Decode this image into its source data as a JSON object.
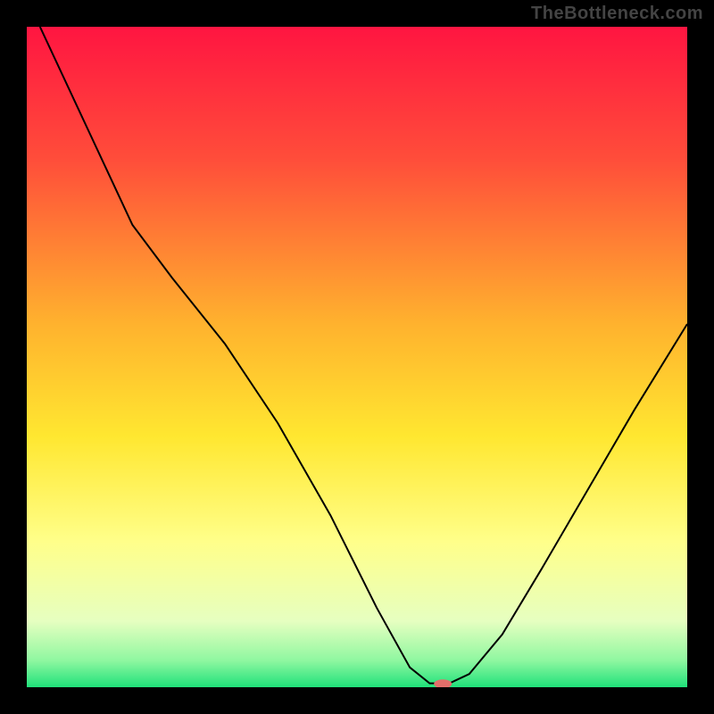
{
  "watermark": "TheBottleneck.com",
  "chart_data": {
    "type": "line",
    "title": "",
    "xlabel": "",
    "ylabel": "",
    "xlim": [
      0,
      100
    ],
    "ylim": [
      0,
      100
    ],
    "grid": false,
    "legend": false,
    "background_gradient_stops": [
      {
        "pct": 0,
        "color": "#ff1541"
      },
      {
        "pct": 20,
        "color": "#ff4d3a"
      },
      {
        "pct": 45,
        "color": "#ffb22e"
      },
      {
        "pct": 62,
        "color": "#ffe730"
      },
      {
        "pct": 78,
        "color": "#ffff8a"
      },
      {
        "pct": 90,
        "color": "#e6ffc0"
      },
      {
        "pct": 96,
        "color": "#8ef7a0"
      },
      {
        "pct": 100,
        "color": "#1fe17a"
      }
    ],
    "series": [
      {
        "name": "bottleneck-curve",
        "color": "#000000",
        "stroke_width": 2,
        "points": [
          {
            "x": 2,
            "y": 100
          },
          {
            "x": 9,
            "y": 85
          },
          {
            "x": 16,
            "y": 70
          },
          {
            "x": 22,
            "y": 62
          },
          {
            "x": 30,
            "y": 52
          },
          {
            "x": 38,
            "y": 40
          },
          {
            "x": 46,
            "y": 26
          },
          {
            "x": 53,
            "y": 12
          },
          {
            "x": 58,
            "y": 3
          },
          {
            "x": 61,
            "y": 0.6
          },
          {
            "x": 64,
            "y": 0.6
          },
          {
            "x": 67,
            "y": 2
          },
          {
            "x": 72,
            "y": 8
          },
          {
            "x": 78,
            "y": 18
          },
          {
            "x": 85,
            "y": 30
          },
          {
            "x": 92,
            "y": 42
          },
          {
            "x": 100,
            "y": 55
          }
        ]
      }
    ],
    "marker": {
      "name": "sweet-spot",
      "x": 63,
      "y": 0.5,
      "color": "#e26f6a",
      "rx": 10,
      "ry": 5
    }
  }
}
